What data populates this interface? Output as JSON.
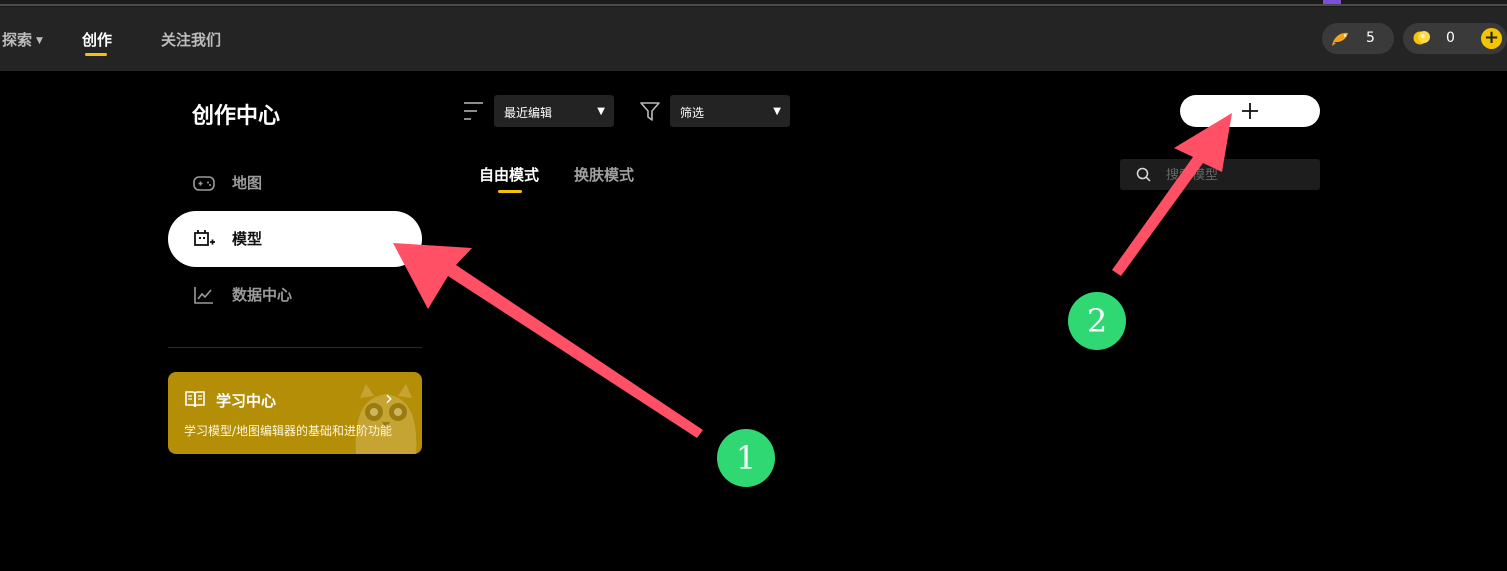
{
  "nav": {
    "explore": "探索",
    "create": "创作",
    "follow": "关注我们",
    "fish_count": "5",
    "coin_count": "0",
    "add_icon": "plus-circle-icon"
  },
  "sidebar": {
    "title": "创作中心",
    "items": [
      {
        "label": "地图",
        "icon": "gamepad-icon",
        "active": false
      },
      {
        "label": "模型",
        "icon": "model-icon",
        "active": true
      },
      {
        "label": "数据中心",
        "icon": "chart-icon",
        "active": false
      }
    ],
    "learn_card": {
      "title": "学习中心",
      "desc": "学习模型/地图编辑器的基础和进阶功能",
      "icon": "book-icon"
    }
  },
  "toolbar": {
    "sort_value": "最近编辑",
    "filter_value": "筛选"
  },
  "tabs": [
    {
      "label": "自由模式",
      "active": true
    },
    {
      "label": "换肤模式",
      "active": false
    }
  ],
  "search": {
    "placeholder": "搜索模型"
  },
  "annotations": {
    "badge_1": "1",
    "badge_2": "2",
    "arrow_color": "#ff5066",
    "badge_color": "#2fd872"
  },
  "colors": {
    "accent": "#f5c400",
    "learn_card": "#b58e08"
  }
}
